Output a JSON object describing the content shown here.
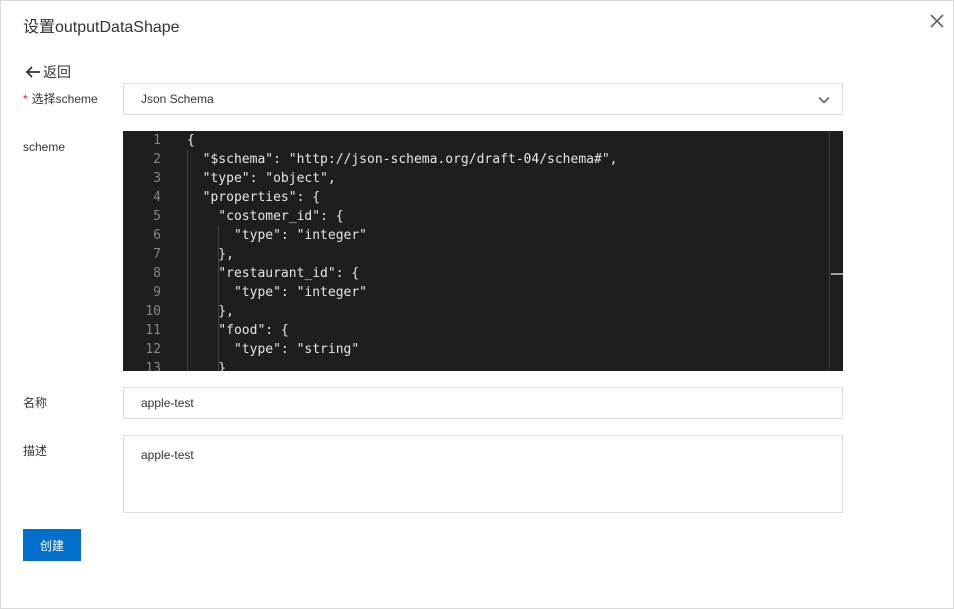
{
  "dialog": {
    "title": "设置outputDataShape",
    "close_icon": "close-icon"
  },
  "back": {
    "label": "返回",
    "icon": "arrow-left-icon"
  },
  "form": {
    "scheme_select": {
      "label": "选择scheme",
      "required_mark": "*",
      "value": "Json Schema",
      "icon": "chevron-down-icon"
    },
    "scheme_editor": {
      "label": "scheme",
      "line_numbers": [
        "1",
        "2",
        "3",
        "4",
        "5",
        "6",
        "7",
        "8",
        "9",
        "10",
        "11",
        "12",
        "13"
      ],
      "lines": [
        "{",
        "  \"$schema\": \"http://json-schema.org/draft-04/schema#\",",
        "  \"type\": \"object\",",
        "  \"properties\": {",
        "    \"costomer_id\": {",
        "      \"type\": \"integer\"",
        "    },",
        "    \"restaurant_id\": {",
        "      \"type\": \"integer\"",
        "    },",
        "    \"food\": {",
        "      \"type\": \"string\"",
        "    }"
      ]
    },
    "name": {
      "label": "名称",
      "value": "apple-test"
    },
    "description": {
      "label": "描述",
      "value": "apple-test"
    },
    "submit": {
      "label": "创建"
    }
  },
  "colors": {
    "primary": "#0070cc",
    "required": "#e02020",
    "editor_bg": "#1e1e1e"
  }
}
